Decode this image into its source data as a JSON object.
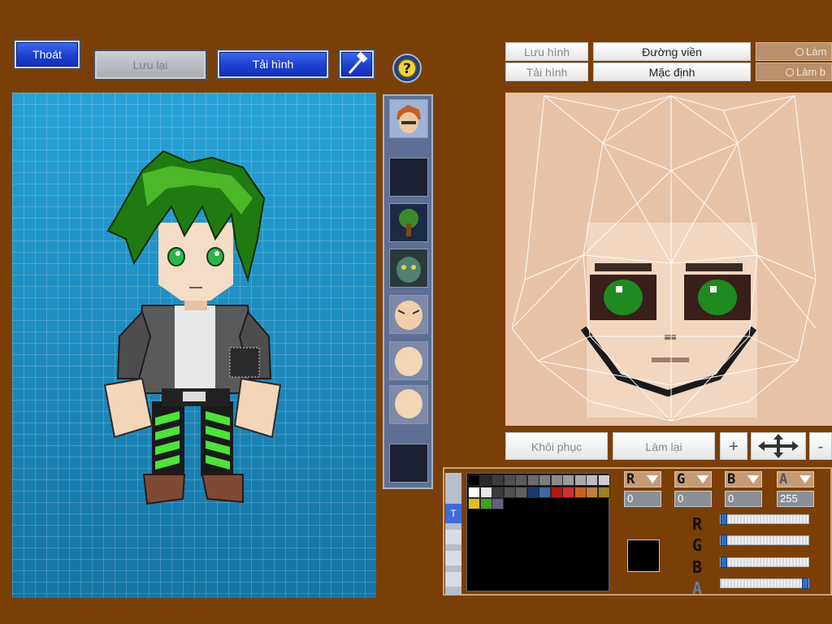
{
  "toolbar": {
    "exit_label": "Thoát",
    "save_label": "Lưu lại",
    "load_label": "Tải hình",
    "tool_icon": "hammer-icon",
    "help_icon": "question-icon"
  },
  "thumbnails": [
    {
      "name": "portrait-thumb",
      "icon": "character-portrait"
    },
    {
      "name": "empty-slot-1",
      "icon": "empty"
    },
    {
      "name": "tree-thumb",
      "icon": "tree"
    },
    {
      "name": "monster-thumb",
      "icon": "monster-face"
    },
    {
      "name": "face-thumb-1",
      "icon": "face"
    },
    {
      "name": "face-thumb-2",
      "icon": "face"
    },
    {
      "name": "face-thumb-3",
      "icon": "face"
    },
    {
      "name": "empty-slot-2",
      "icon": "empty"
    }
  ],
  "right_panel": {
    "save_image": "Lưu hình",
    "load_image": "Tải hình",
    "outline": "Đường viền",
    "default": "Mặc định",
    "radio_1": "Làm",
    "radio_2": "Làm b",
    "restore": "Khôi phục",
    "redo": "Làm lại",
    "plus": "+",
    "minus": "-"
  },
  "color_editor": {
    "tab_label": "T",
    "channels": [
      {
        "label": "R",
        "value": "0"
      },
      {
        "label": "G",
        "value": "0"
      },
      {
        "label": "B",
        "value": "0"
      },
      {
        "label": "A",
        "value": "255"
      }
    ],
    "sliders": [
      {
        "label": "R",
        "level": 0
      },
      {
        "label": "G",
        "level": 0
      },
      {
        "label": "B",
        "level": 0
      },
      {
        "label": "A",
        "level": 1
      }
    ],
    "current_color": "#000000",
    "palette_row1": [
      "#000000",
      "#2a2a2a",
      "#3d3d3d",
      "#4f4f4f",
      "#5c5c5c",
      "#6b6b6b",
      "#7d7d7d",
      "#8a8a8a",
      "#9a9a9a",
      "#aaaaaa",
      "#bdbdbd",
      "#cfcfcf"
    ],
    "palette_row2": [
      "#ffffff",
      "#e6e6e6",
      "#3a3a3a",
      "#505050",
      "#606060",
      "#1a3a6a",
      "#3a6aa0",
      "#b01818",
      "#d03030",
      "#d06020",
      "#c08040",
      "#a08020"
    ],
    "palette_row3": [
      "#e0c020",
      "#40a020",
      "#606080"
    ]
  },
  "colors": {
    "background": "#7a3f06",
    "canvas_blue": "#1d8cbf",
    "accent_blue": "#1d3fd0"
  }
}
